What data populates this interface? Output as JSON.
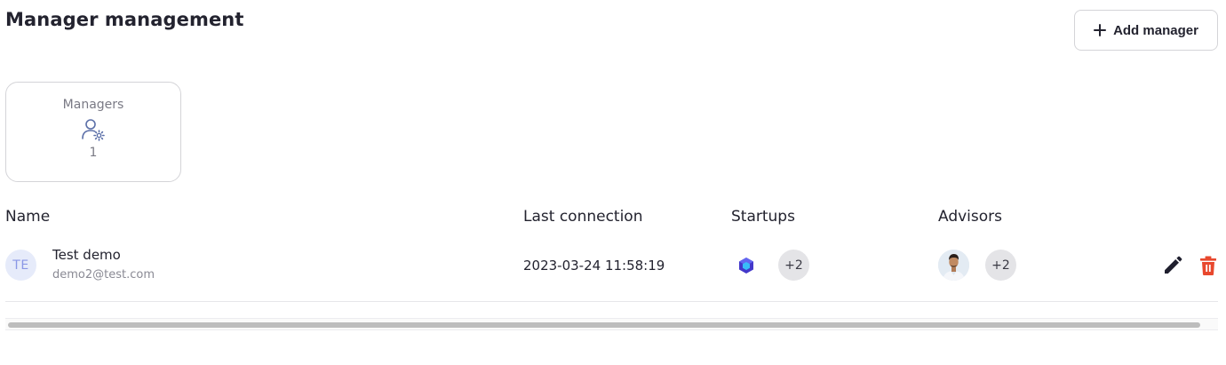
{
  "page": {
    "title": "Manager management"
  },
  "toolbar": {
    "add_label": "Add manager",
    "add_icon": "plus-icon"
  },
  "stats": {
    "label": "Managers",
    "icon": "user-gear-icon",
    "value": "1"
  },
  "table": {
    "headers": {
      "name": "Name",
      "last_connection": "Last connection",
      "startups": "Startups",
      "advisors": "Advisors"
    },
    "rows": [
      {
        "initials": "TE",
        "name": "Test demo",
        "email": "demo2@test.com",
        "last_connection": "2023-03-24 11:58:19",
        "startups_extra": "+2",
        "advisors_extra": "+2",
        "actions": [
          "pencil-icon",
          "trash-icon"
        ]
      }
    ]
  },
  "colors": {
    "accent": "#4f46e5",
    "danger": "#e8482e",
    "badge_bg": "#e4e4e7",
    "initials_bg": "#e6ebfa"
  }
}
